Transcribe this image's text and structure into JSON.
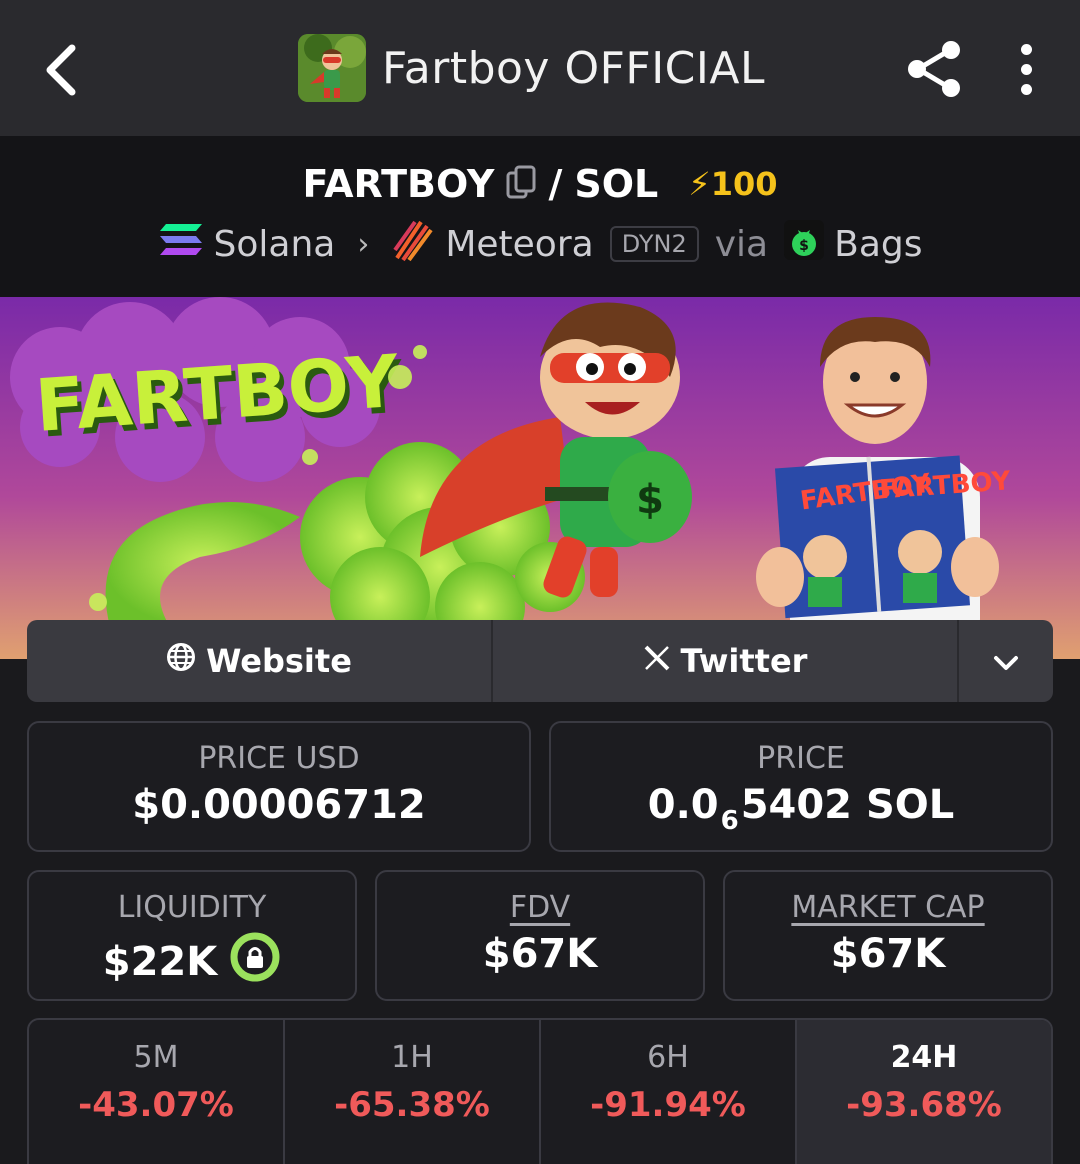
{
  "topbar": {
    "title": "Fartboy OFFICIAL"
  },
  "pair": {
    "base": "FARTBOY",
    "separator": "/",
    "quote": "SOL",
    "boost": "⚡100",
    "chain": "Solana",
    "dex": "Meteora",
    "dex_tag": "DYN2",
    "via": "via",
    "launchpad": "Bags"
  },
  "banner": {
    "logo_text": "FARTBOY"
  },
  "links": {
    "website": "Website",
    "twitter": "Twitter"
  },
  "stats": {
    "price_usd": {
      "label": "PRICE USD",
      "value": "$0.00006712"
    },
    "price": {
      "label": "PRICE",
      "prefix": "0.0",
      "subscript": "6",
      "suffix": "5402 SOL"
    },
    "liquidity": {
      "label": "LIQUIDITY",
      "value": "$22K"
    },
    "fdv": {
      "label": "FDV",
      "value": "$67K"
    },
    "market_cap": {
      "label": "MARKET CAP",
      "value": "$67K"
    }
  },
  "timeframes": [
    {
      "label": "5M",
      "change": "-43.07%"
    },
    {
      "label": "1H",
      "change": "-65.38%"
    },
    {
      "label": "6H",
      "change": "-91.94%"
    },
    {
      "label": "24H",
      "change": "-93.68%"
    }
  ],
  "colors": {
    "negative": "#f05a5a",
    "boost": "#f5c21b",
    "lock": "#9be15d"
  }
}
